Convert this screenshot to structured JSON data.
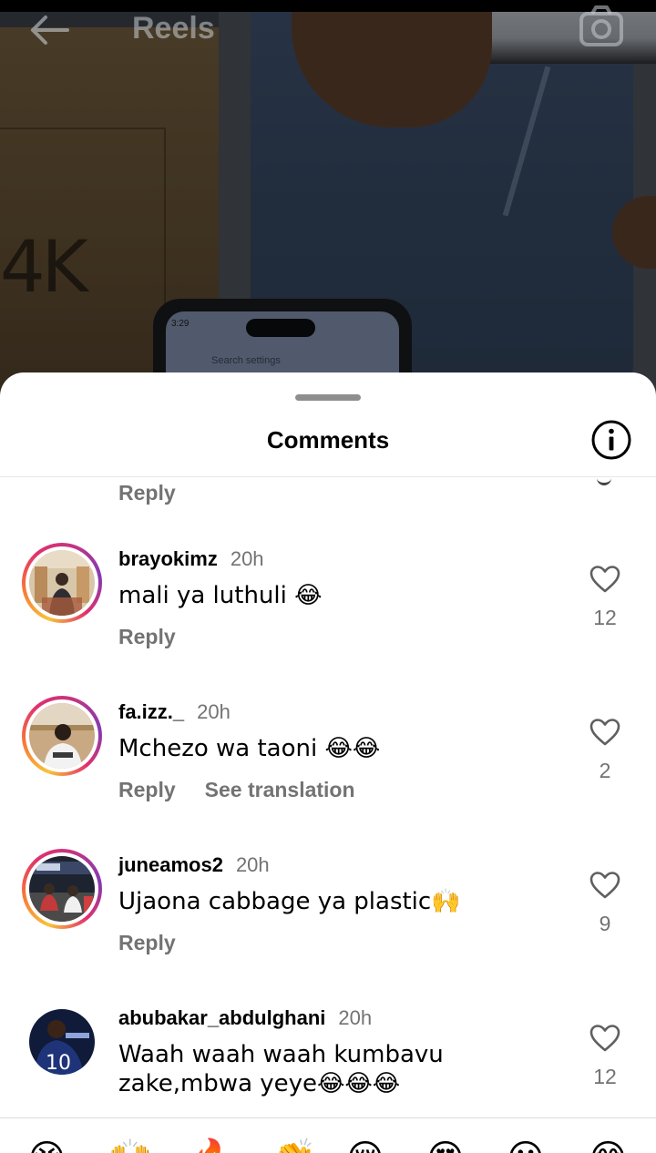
{
  "header": {
    "title": "Reels",
    "back_icon": "arrow-left-icon",
    "camera_icon": "camera-icon"
  },
  "background_phone": {
    "time": "3:29",
    "search_placeholder": "Search settings"
  },
  "background_box_text": "4K",
  "sheet": {
    "title": "Comments",
    "info_icon": "info-icon"
  },
  "partial_comment": {
    "reply_label": "Reply"
  },
  "comments": [
    {
      "username": "brayokimz",
      "time": "20h",
      "text": "mali ya luthuli 😂",
      "reply_label": "Reply",
      "likes": "12",
      "story_ring": true
    },
    {
      "username": "fa.izz._",
      "time": "20h",
      "text": "Mchezo wa taoni 😂😂",
      "reply_label": "Reply",
      "translate_label": "See translation",
      "likes": "2",
      "story_ring": true
    },
    {
      "username": "juneamos2",
      "time": "20h",
      "text": "Ujaona cabbage ya plastic🙌",
      "reply_label": "Reply",
      "likes": "9",
      "story_ring": true
    },
    {
      "username": "abubakar_abdulghani",
      "time": "20h",
      "text": "Waah waah waah kumbavu zake,mbwa yeye😂😂😂",
      "likes": "12",
      "story_ring": false
    }
  ],
  "emoji_bar": [
    "😭",
    "🙌",
    "🔥",
    "👏",
    "😢",
    "😍",
    "😮",
    "😂"
  ],
  "colors": {
    "secondary_text": "#737373",
    "story_ring_start": "#f9c33a",
    "story_ring_end": "#c13584"
  }
}
